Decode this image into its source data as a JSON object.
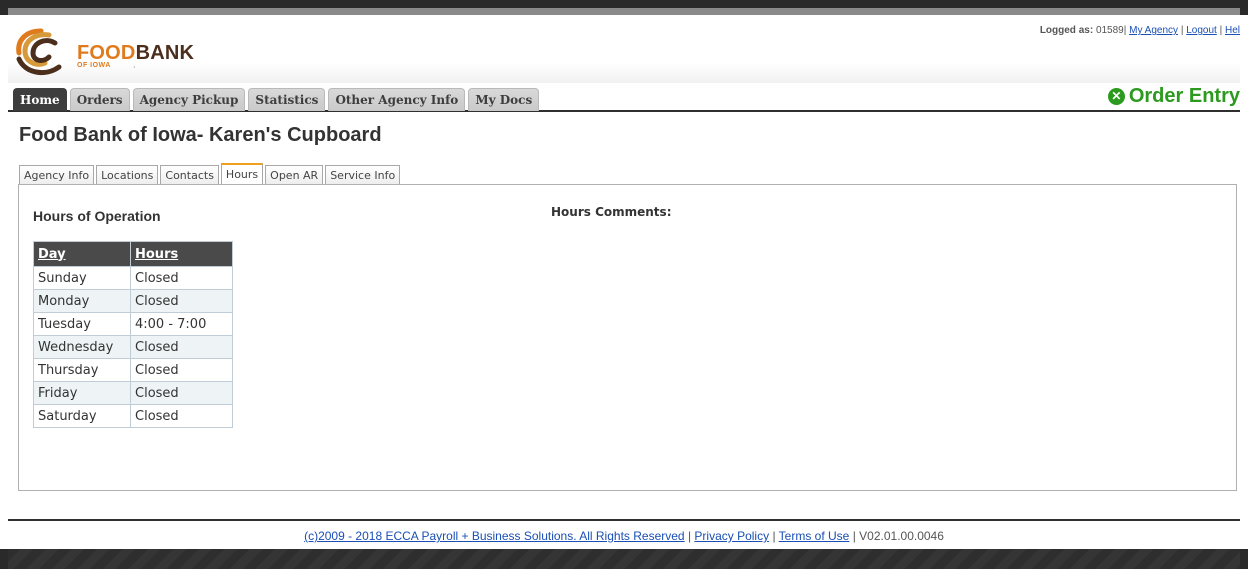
{
  "header": {
    "logo_food": "FOOD",
    "logo_bank": "BANK",
    "logo_sub": "OF IOWA",
    "logged_as_label": "Logged as:",
    "logged_as_value": "01589|",
    "links": {
      "my_agency": "My Agency",
      "logout": "Logout",
      "help": "Hel"
    }
  },
  "nav": {
    "tabs": [
      "Home",
      "Orders",
      "Agency Pickup",
      "Statistics",
      "Other Agency Info",
      "My Docs"
    ],
    "active_tab": "Home",
    "order_entry": "Order Entry",
    "order_entry_icon": "close-circle-icon"
  },
  "page_title": "Food Bank of Iowa- Karen's Cupboard",
  "subtabs": [
    "Agency Info",
    "Locations",
    "Contacts",
    "Hours",
    "Open AR",
    "Service Info"
  ],
  "active_subtab": "Hours",
  "hours": {
    "section_title": "Hours of Operation",
    "comments_label": "Hours Comments:",
    "columns": [
      "Day",
      "Hours"
    ],
    "rows": [
      {
        "day": "Sunday",
        "hours": "Closed"
      },
      {
        "day": "Monday",
        "hours": "Closed"
      },
      {
        "day": "Tuesday",
        "hours": "4:00 - 7:00"
      },
      {
        "day": "Wednesday",
        "hours": "Closed"
      },
      {
        "day": "Thursday",
        "hours": "Closed"
      },
      {
        "day": "Friday",
        "hours": "Closed"
      },
      {
        "day": "Saturday",
        "hours": "Closed"
      }
    ]
  },
  "footer": {
    "copyright": "(c)2009 - 2018 ECCA Payroll + Business Solutions. All Rights Reserved",
    "privacy": "Privacy Policy",
    "terms": "Terms of Use",
    "version": "V02.01.00.0046"
  },
  "colors": {
    "accent_orange": "#e07b1d",
    "brand_brown": "#4b2e1c",
    "order_green": "#2c9a1e",
    "nav_dark": "#3d3d3d"
  }
}
